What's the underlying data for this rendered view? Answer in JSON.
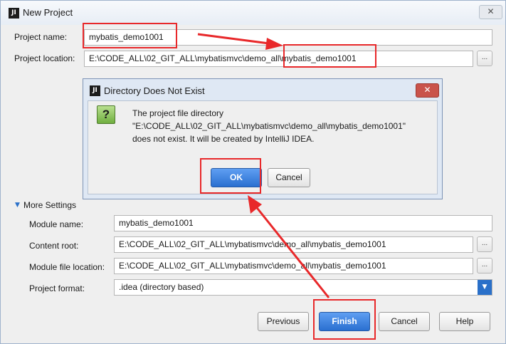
{
  "window": {
    "title": "New Project",
    "close_symbol": "✕",
    "app_icon_text": "JI"
  },
  "form": {
    "project_name_label": "Project name:",
    "project_name_value": "mybatis_demo1001",
    "project_location_label": "Project location:",
    "project_location_value": "E:\\CODE_ALL\\02_GIT_ALL\\mybatismvc\\demo_all\\mybatis_demo1001",
    "browse_label": "..."
  },
  "dialog": {
    "title": "Directory Does Not Exist",
    "close_symbol": "✕",
    "icon_glyph": "?",
    "message_line1": "The project file directory",
    "message_line2": "\"E:\\CODE_ALL\\02_GIT_ALL\\mybatismvc\\demo_all\\mybatis_demo1001\"",
    "message_line3": "does not exist. It will be created by IntelliJ IDEA.",
    "ok_label": "OK",
    "cancel_label": "Cancel"
  },
  "more_settings": {
    "section_label": "More Settings",
    "section_arrow": "▼",
    "module_name_label": "Module name:",
    "module_name_value": "mybatis_demo1001",
    "content_root_label": "Content root:",
    "content_root_value": "E:\\CODE_ALL\\02_GIT_ALL\\mybatismvc\\demo_all\\mybatis_demo1001",
    "module_file_location_label": "Module file location:",
    "module_file_location_value": "E:\\CODE_ALL\\02_GIT_ALL\\mybatismvc\\demo_all\\mybatis_demo1001",
    "project_format_label": "Project format:",
    "project_format_value": ".idea (directory based)",
    "dropdown_symbol": "▼",
    "browse_label": "..."
  },
  "footer": {
    "previous_label": "Previous",
    "finish_label": "Finish",
    "cancel_label": "Cancel",
    "help_label": "Help"
  },
  "colors": {
    "annotation_red": "#e8282a",
    "primary_blue": "#2a6fd0",
    "window_bg": "#efefef"
  }
}
